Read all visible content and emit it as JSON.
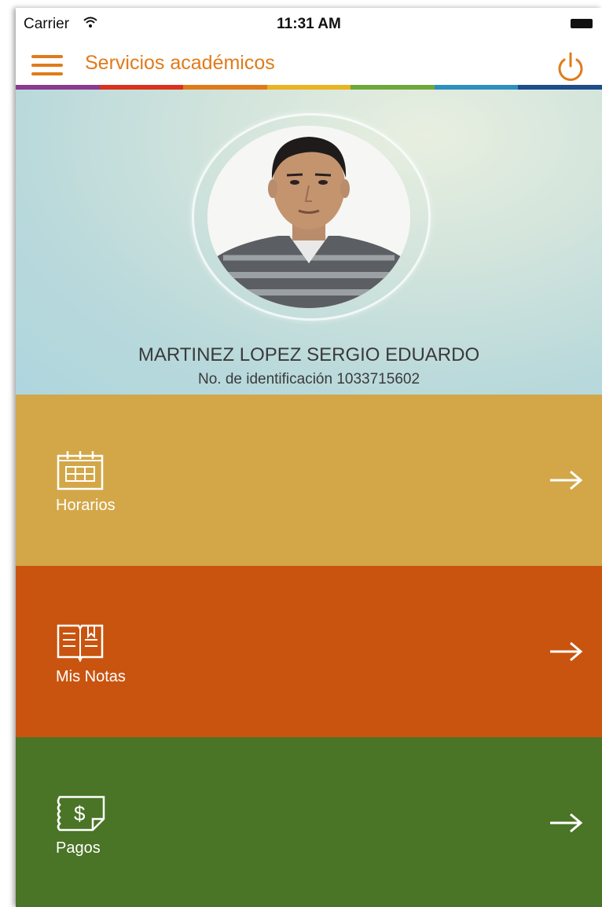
{
  "status_bar": {
    "carrier": "Carrier",
    "time": "11:31 AM"
  },
  "nav": {
    "title": "Servicios académicos",
    "menu_icon": "hamburger-menu-icon",
    "power_icon": "power-icon"
  },
  "colors": {
    "accent": "#e07b1a",
    "horarios": "#d3a748",
    "notas": "#c9540f",
    "pagos": "#4a7426",
    "strip": [
      "#8b3a8f",
      "#d9331d",
      "#e07b1a",
      "#e9b323",
      "#6fa83a",
      "#2f8fbf",
      "#1d4d8a"
    ]
  },
  "profile": {
    "name": "MARTINEZ LOPEZ SERGIO EDUARDO",
    "id_text": "No. de identificación 1033715602"
  },
  "menu": [
    {
      "label": "Horarios",
      "icon": "calendar-icon"
    },
    {
      "label": "Mis Notas",
      "icon": "open-book-icon"
    },
    {
      "label": "Pagos",
      "icon": "receipt-dollar-icon"
    }
  ]
}
